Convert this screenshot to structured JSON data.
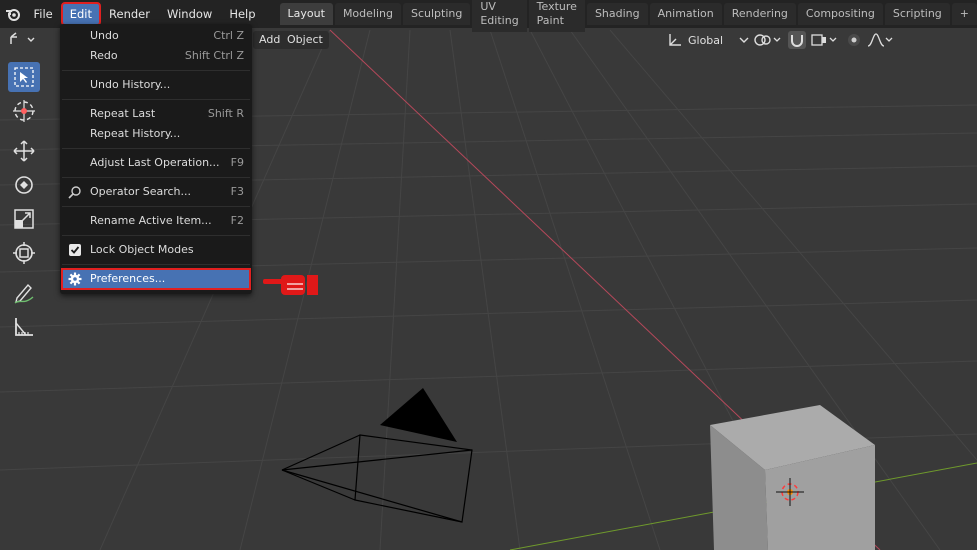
{
  "topbar": {
    "menus": [
      "File",
      "Edit",
      "Render",
      "Window",
      "Help"
    ],
    "workspaces": [
      "Layout",
      "Modeling",
      "Sculpting",
      "UV Editing",
      "Texture Paint",
      "Shading",
      "Animation",
      "Rendering",
      "Compositing",
      "Scripting"
    ],
    "active_menu": "Edit",
    "active_workspace": "Layout"
  },
  "header": {
    "add_label": "Add",
    "object_label": "Object",
    "orientation_value": "Global"
  },
  "edit_menu": {
    "items": [
      {
        "label": "Undo",
        "shortcut": "Ctrl Z"
      },
      {
        "label": "Redo",
        "shortcut": "Shift Ctrl Z"
      },
      {
        "label": "Undo History...",
        "shortcut": ""
      },
      {
        "label": "Repeat Last",
        "shortcut": "Shift R"
      },
      {
        "label": "Repeat History...",
        "shortcut": ""
      },
      {
        "label": "Adjust Last Operation...",
        "shortcut": "F9"
      },
      {
        "label": "Operator Search...",
        "shortcut": "F3",
        "icon": "search-icon"
      },
      {
        "label": "Rename Active Item...",
        "shortcut": "F2"
      },
      {
        "label": "Lock Object Modes",
        "shortcut": "",
        "icon": "checkbox-checked-icon"
      },
      {
        "label": "Preferences...",
        "shortcut": "",
        "icon": "gear-icon",
        "highlighted": true
      }
    ]
  },
  "toolbar": {
    "tools": [
      "select-box-icon",
      "cursor-icon",
      "move-icon",
      "rotate-icon",
      "scale-icon",
      "transform-icon",
      "annotate-icon",
      "measure-icon"
    ]
  },
  "colors": {
    "accent": "#4772b3",
    "highlight_outline": "#e02020",
    "viewport_bg": "#393939",
    "x_axis": "#b5485a",
    "y_axis": "#6f9a2c"
  }
}
